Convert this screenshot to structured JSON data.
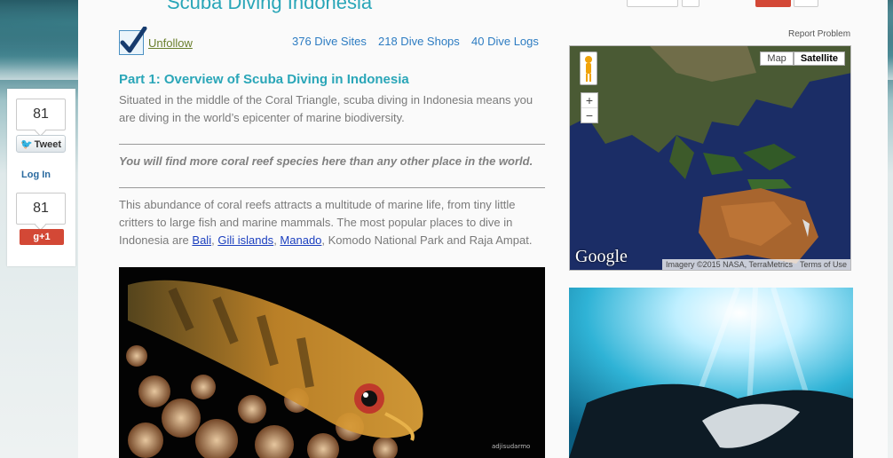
{
  "site": {
    "title": "Scuba Diving Indonesia"
  },
  "social": {
    "tweet_count": "81",
    "tweet_label": "Tweet",
    "login_label": "Log In",
    "gplus_count": "81",
    "gplus_label": "g+1"
  },
  "follow": {
    "label": "Unfollow"
  },
  "stats": [
    {
      "label": "376 Dive Sites"
    },
    {
      "label": "218 Dive Shops"
    },
    {
      "label": "40 Dive Logs"
    }
  ],
  "article": {
    "section_title": "Part 1: Overview of Scuba Diving in Indonesia",
    "intro": "Situated in the middle of the Coral Triangle, scuba diving in Indonesia means you are diving in the world’s epicenter of marine biodiversity.",
    "quote": "You will find more coral reef species here than any other place in the world.",
    "body_before": "This abundance of coral reefs attracts a multitude of marine life, from tiny little critters to large fish and marine mammals. The most popular places to dive in Indonesia are ",
    "link_bali": "Bali",
    "sep1": ", ",
    "link_gili": "Gili islands",
    "sep2": ", ",
    "link_manado": "Manado",
    "body_after": ", Komodo National Park and Raja Ampat.",
    "photo_credit": "adjisudarmo"
  },
  "map": {
    "report_problem": "Report Problem",
    "map_button": "Map",
    "satellite_button": "Satellite",
    "zoom_in": "+",
    "zoom_out": "−",
    "logo": "Google",
    "imagery": "Imagery ©2015 NASA, TerraMetrics",
    "terms": "Terms of Use"
  }
}
